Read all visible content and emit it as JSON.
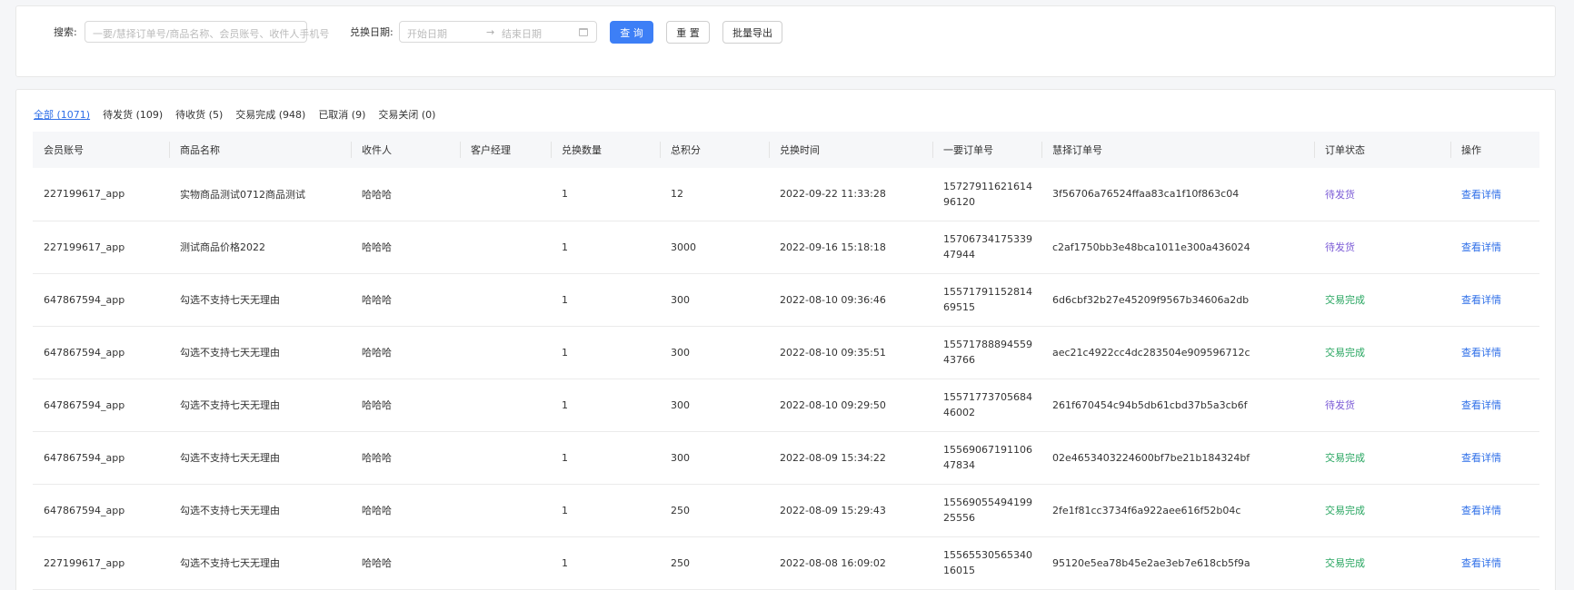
{
  "search": {
    "label": "搜索:",
    "placeholder": "一要/慧择订单号/商品名称、会员账号、收件人手机号",
    "date_label": "兑换日期:",
    "start_placeholder": "开始日期",
    "arrow": "→",
    "end_placeholder": "结束日期",
    "query_button": "查 询",
    "reset_button": "重 置",
    "export_button": "批量导出"
  },
  "tabs": [
    {
      "label": "全部 (1071)",
      "active": true
    },
    {
      "label": "待发货 (109)"
    },
    {
      "label": "待收货 (5)"
    },
    {
      "label": "交易完成 (948)"
    },
    {
      "label": "已取消 (9)"
    },
    {
      "label": "交易关闭 (0)"
    }
  ],
  "table": {
    "columns": [
      "会员账号",
      "商品名称",
      "收件人",
      "客户经理",
      "兑换数量",
      "总积分",
      "兑换时间",
      "一要订单号",
      "慧择订单号",
      "订单状态",
      "操作"
    ],
    "rows": [
      {
        "account": "227199617_app",
        "product": "实物商品测试0712商品测试",
        "recipient": "哈哈哈",
        "manager": "",
        "qty": "1",
        "points": "12",
        "time": "2022-09-22 11:33:28",
        "order_id": "1572791162161496120",
        "hz_order": "3f56706a76524ffaa83ca1f10f863c04",
        "status": "待发货",
        "status_type": "pending",
        "action": "查看详情"
      },
      {
        "account": "227199617_app",
        "product": "测试商品价格2022",
        "recipient": "哈哈哈",
        "manager": "",
        "qty": "1",
        "points": "3000",
        "time": "2022-09-16 15:18:18",
        "order_id": "1570673417533947944",
        "hz_order": "c2af1750bb3e48bca1011e300a436024",
        "status": "待发货",
        "status_type": "pending",
        "action": "查看详情"
      },
      {
        "account": "647867594_app",
        "product": "勾选不支持七天无理由",
        "recipient": "哈哈哈",
        "manager": "",
        "qty": "1",
        "points": "300",
        "time": "2022-08-10 09:36:46",
        "order_id": "1557179115281469515",
        "hz_order": "6d6cbf32b27e45209f9567b34606a2db",
        "status": "交易完成",
        "status_type": "done",
        "action": "查看详情"
      },
      {
        "account": "647867594_app",
        "product": "勾选不支持七天无理由",
        "recipient": "哈哈哈",
        "manager": "",
        "qty": "1",
        "points": "300",
        "time": "2022-08-10 09:35:51",
        "order_id": "1557178889455943766",
        "hz_order": "aec21c4922cc4dc283504e909596712c",
        "status": "交易完成",
        "status_type": "done",
        "action": "查看详情"
      },
      {
        "account": "647867594_app",
        "product": "勾选不支持七天无理由",
        "recipient": "哈哈哈",
        "manager": "",
        "qty": "1",
        "points": "300",
        "time": "2022-08-10 09:29:50",
        "order_id": "1557177370568446002",
        "hz_order": "261f670454c94b5db61cbd37b5a3cb6f",
        "status": "待发货",
        "status_type": "pending",
        "action": "查看详情"
      },
      {
        "account": "647867594_app",
        "product": "勾选不支持七天无理由",
        "recipient": "哈哈哈",
        "manager": "",
        "qty": "1",
        "points": "300",
        "time": "2022-08-09 15:34:22",
        "order_id": "1556906719110647834",
        "hz_order": "02e4653403224600bf7be21b184324bf",
        "status": "交易完成",
        "status_type": "done",
        "action": "查看详情"
      },
      {
        "account": "647867594_app",
        "product": "勾选不支持七天无理由",
        "recipient": "哈哈哈",
        "manager": "",
        "qty": "1",
        "points": "250",
        "time": "2022-08-09 15:29:43",
        "order_id": "1556905549419925556",
        "hz_order": "2fe1f81cc3734f6a922aee616f52b04c",
        "status": "交易完成",
        "status_type": "done",
        "action": "查看详情"
      },
      {
        "account": "227199617_app",
        "product": "勾选不支持七天无理由",
        "recipient": "哈哈哈",
        "manager": "",
        "qty": "1",
        "points": "250",
        "time": "2022-08-08 16:09:02",
        "order_id": "1556553056534016015",
        "hz_order": "95120e5ea78b45e2ae3eb7e618cb5f9a",
        "status": "交易完成",
        "status_type": "done",
        "action": "查看详情"
      }
    ]
  },
  "colors": {
    "primary": "#3d7ff6",
    "link": "#2f6fe8",
    "pending": "#7b5bd6",
    "done": "#26a55f"
  }
}
